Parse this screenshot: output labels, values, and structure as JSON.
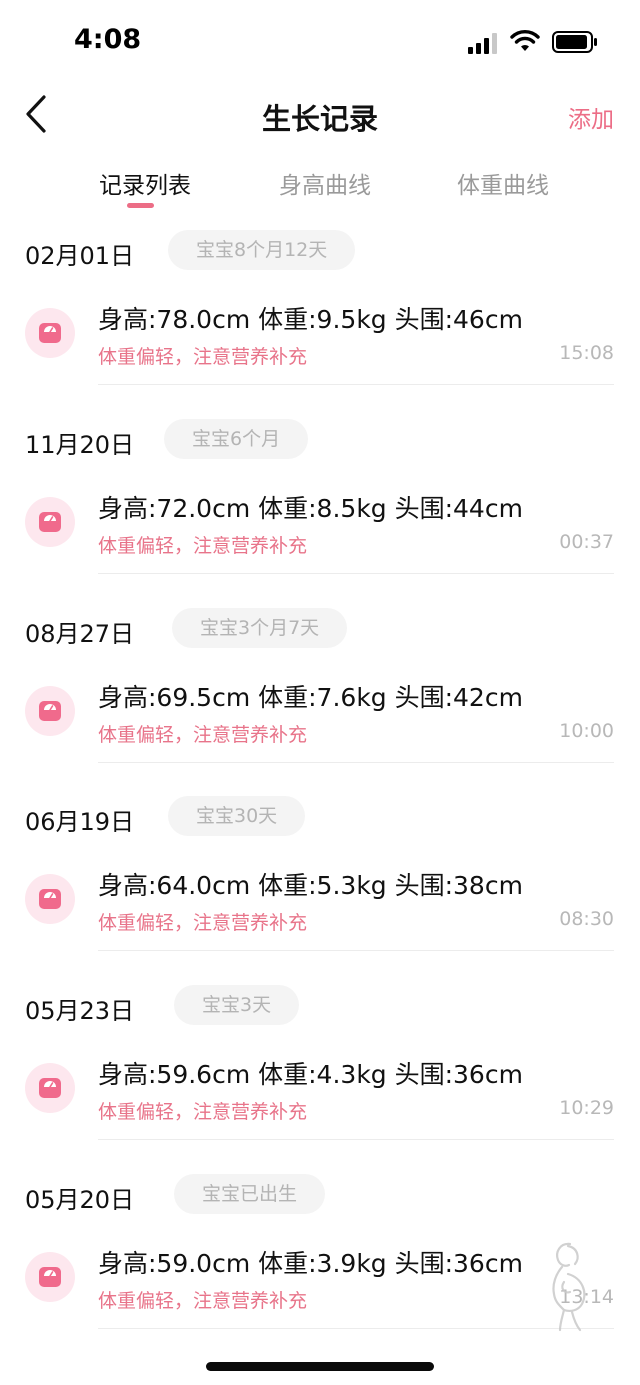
{
  "status_bar": {
    "time": "4:08"
  },
  "nav": {
    "title": "生长记录",
    "add_label": "添加"
  },
  "tabs": [
    {
      "label": "记录列表",
      "active": true
    },
    {
      "label": "身高曲线",
      "active": false
    },
    {
      "label": "体重曲线",
      "active": false
    }
  ],
  "records": [
    {
      "date": "02月01日",
      "age": "宝宝8个月12天",
      "measure": "身高:78.0cm 体重:9.5kg 头围:46cm",
      "advice": "体重偏轻，注意营养补充",
      "time": "15:08"
    },
    {
      "date": "11月20日",
      "age": "宝宝6个月",
      "measure": "身高:72.0cm 体重:8.5kg 头围:44cm",
      "advice": "体重偏轻，注意营养补充",
      "time": "00:37"
    },
    {
      "date": "08月27日",
      "age": "宝宝3个月7天",
      "measure": "身高:69.5cm 体重:7.6kg 头围:42cm",
      "advice": "体重偏轻，注意营养补充",
      "time": "10:00"
    },
    {
      "date": "06月19日",
      "age": "宝宝30天",
      "measure": "身高:64.0cm 体重:5.3kg 头围:38cm",
      "advice": "体重偏轻，注意营养补充",
      "time": "08:30"
    },
    {
      "date": "05月23日",
      "age": "宝宝3天",
      "measure": "身高:59.6cm 体重:4.3kg 头围:36cm",
      "advice": "体重偏轻，注意营养补充",
      "time": "10:29"
    },
    {
      "date": "05月20日",
      "age": "宝宝已出生",
      "measure": "身高:59.0cm 体重:3.9kg 头围:36cm",
      "advice": "体重偏轻，注意营养补充",
      "time": "13:14"
    }
  ],
  "colors": {
    "accent": "#ec6d86",
    "advice_text": "#e8748a",
    "icon_bg": "#fde7ee",
    "badge_bg": "#f4f4f4"
  },
  "icons": {
    "back": "chevron-left-icon",
    "record": "scale-icon",
    "mascot": "pregnant-woman-icon"
  }
}
